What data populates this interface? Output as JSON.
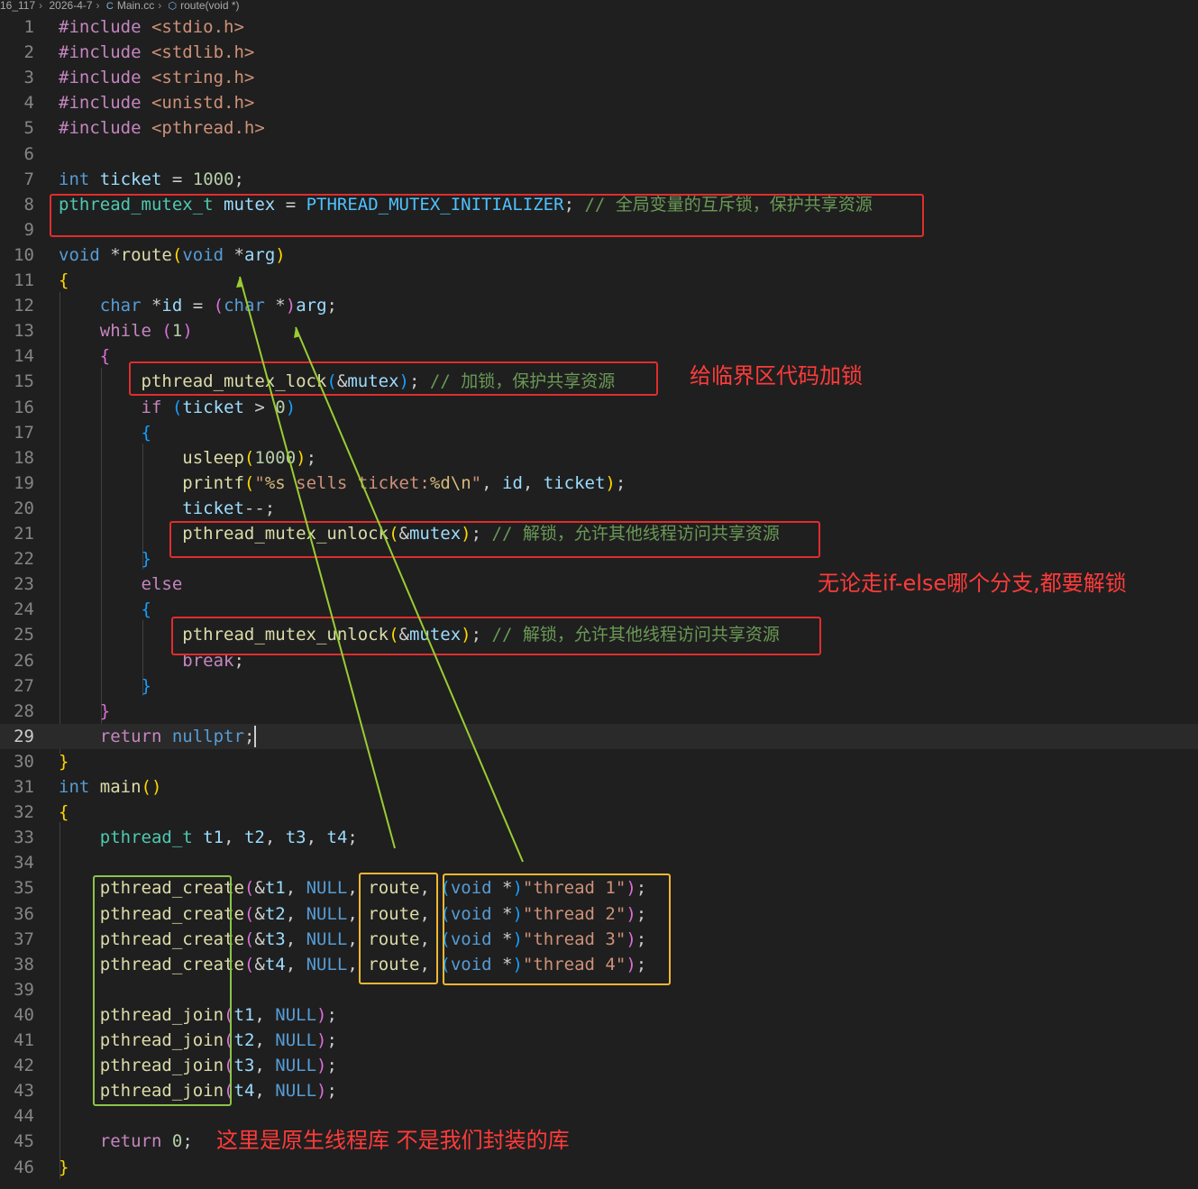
{
  "breadcrumb": [
    "16_117",
    "2026-4-7",
    "Main.cc",
    "route(void *)"
  ],
  "breadcrumb_icons": {
    "file": "cpp-file-icon",
    "symbol": "function-symbol-icon"
  },
  "colors": {
    "red_box": "#e02d2d",
    "yellow_box": "#f2b733",
    "green_box": "#8bc34a",
    "arrow": "#9acd32",
    "note_text": "#ff3b3b"
  },
  "current_line": 29,
  "annotations": {
    "note1": "给临界区代码加锁",
    "note2": "无论走if-else哪个分支,都要解锁",
    "note3": "这里是原生线程库 不是我们封装的库"
  },
  "lines": [
    [
      [
        "#include",
        "pp"
      ],
      [
        " <stdio.h>",
        "inc"
      ]
    ],
    [
      [
        "#include",
        "pp"
      ],
      [
        " <stdlib.h>",
        "inc"
      ]
    ],
    [
      [
        "#include",
        "pp"
      ],
      [
        " <string.h>",
        "inc"
      ]
    ],
    [
      [
        "#include",
        "pp"
      ],
      [
        " <unistd.h>",
        "inc"
      ]
    ],
    [
      [
        "#include",
        "pp"
      ],
      [
        " <pthread.h>",
        "inc"
      ]
    ],
    [],
    [
      [
        "int",
        "kw"
      ],
      [
        " ",
        "plain"
      ],
      [
        "ticket",
        "var"
      ],
      [
        " = ",
        "plain"
      ],
      [
        "1000",
        "num"
      ],
      [
        ";",
        "plain"
      ]
    ],
    [
      [
        "pthread_mutex_t",
        "type"
      ],
      [
        " ",
        "plain"
      ],
      [
        "mutex",
        "var"
      ],
      [
        " = ",
        "plain"
      ],
      [
        "PTHREAD_MUTEX_INITIALIZER",
        "mac"
      ],
      [
        "; ",
        "plain"
      ],
      [
        "// 全局变量的互斥锁，保护共享资源",
        "cmt"
      ]
    ],
    [],
    [
      [
        "void",
        "kw"
      ],
      [
        " *",
        "plain"
      ],
      [
        "route",
        "fn"
      ],
      [
        "(",
        "br1"
      ],
      [
        "void",
        "kw"
      ],
      [
        " *",
        "plain"
      ],
      [
        "arg",
        "var"
      ],
      [
        ")",
        "br1"
      ]
    ],
    [
      [
        "{",
        "br1"
      ]
    ],
    [
      [
        "    ",
        "plain"
      ],
      [
        "char",
        "kw"
      ],
      [
        " *",
        "plain"
      ],
      [
        "id",
        "var"
      ],
      [
        " = ",
        "plain"
      ],
      [
        "(",
        "br2"
      ],
      [
        "char",
        "kw"
      ],
      [
        " *",
        "plain"
      ],
      [
        ")",
        "br2"
      ],
      [
        "arg",
        "var"
      ],
      [
        ";",
        "plain"
      ]
    ],
    [
      [
        "    ",
        "plain"
      ],
      [
        "while",
        "ctl"
      ],
      [
        " ",
        "plain"
      ],
      [
        "(",
        "br2"
      ],
      [
        "1",
        "num"
      ],
      [
        ")",
        "br2"
      ]
    ],
    [
      [
        "    ",
        "plain"
      ],
      [
        "{",
        "br2"
      ]
    ],
    [
      [
        "        ",
        "plain"
      ],
      [
        "pthread_mutex_lock",
        "fn"
      ],
      [
        "(",
        "br3"
      ],
      [
        "&",
        "plain"
      ],
      [
        "mutex",
        "var"
      ],
      [
        ")",
        "br3"
      ],
      [
        "; ",
        "plain"
      ],
      [
        "// 加锁，保护共享资源",
        "cmt"
      ]
    ],
    [
      [
        "        ",
        "plain"
      ],
      [
        "if",
        "ctl"
      ],
      [
        " ",
        "plain"
      ],
      [
        "(",
        "br3"
      ],
      [
        "ticket",
        "var"
      ],
      [
        " > ",
        "plain"
      ],
      [
        "0",
        "num"
      ],
      [
        ")",
        "br3"
      ]
    ],
    [
      [
        "        ",
        "plain"
      ],
      [
        "{",
        "br3"
      ]
    ],
    [
      [
        "            ",
        "plain"
      ],
      [
        "usleep",
        "fn"
      ],
      [
        "(",
        "br1"
      ],
      [
        "1000",
        "num"
      ],
      [
        ")",
        "br1"
      ],
      [
        ";",
        "plain"
      ]
    ],
    [
      [
        "            ",
        "plain"
      ],
      [
        "printf",
        "fn"
      ],
      [
        "(",
        "br1"
      ],
      [
        "\"",
        "str"
      ],
      [
        "%s",
        "esc"
      ],
      [
        " sells ticket:",
        "str"
      ],
      [
        "%d",
        "esc"
      ],
      [
        "\\n",
        "esc"
      ],
      [
        "\"",
        "str"
      ],
      [
        ", ",
        "plain"
      ],
      [
        "id",
        "var"
      ],
      [
        ", ",
        "plain"
      ],
      [
        "ticket",
        "var"
      ],
      [
        ")",
        "br1"
      ],
      [
        ";",
        "plain"
      ]
    ],
    [
      [
        "            ",
        "plain"
      ],
      [
        "ticket",
        "var"
      ],
      [
        "--;",
        "plain"
      ]
    ],
    [
      [
        "            ",
        "plain"
      ],
      [
        "pthread_mutex_unlock",
        "fn"
      ],
      [
        "(",
        "br1"
      ],
      [
        "&",
        "plain"
      ],
      [
        "mutex",
        "var"
      ],
      [
        ")",
        "br1"
      ],
      [
        "; ",
        "plain"
      ],
      [
        "// 解锁，允许其他线程访问共享资源",
        "cmt"
      ]
    ],
    [
      [
        "        ",
        "plain"
      ],
      [
        "}",
        "br3"
      ]
    ],
    [
      [
        "        ",
        "plain"
      ],
      [
        "else",
        "ctl"
      ]
    ],
    [
      [
        "        ",
        "plain"
      ],
      [
        "{",
        "br3"
      ]
    ],
    [
      [
        "            ",
        "plain"
      ],
      [
        "pthread_mutex_unlock",
        "fn"
      ],
      [
        "(",
        "br1"
      ],
      [
        "&",
        "plain"
      ],
      [
        "mutex",
        "var"
      ],
      [
        ")",
        "br1"
      ],
      [
        "; ",
        "plain"
      ],
      [
        "// 解锁，允许其他线程访问共享资源",
        "cmt"
      ]
    ],
    [
      [
        "            ",
        "plain"
      ],
      [
        "break",
        "ctl"
      ],
      [
        ";",
        "plain"
      ]
    ],
    [
      [
        "        ",
        "plain"
      ],
      [
        "}",
        "br3"
      ]
    ],
    [
      [
        "    ",
        "plain"
      ],
      [
        "}",
        "br2"
      ]
    ],
    [
      [
        "    ",
        "plain"
      ],
      [
        "return",
        "ctl"
      ],
      [
        " ",
        "plain"
      ],
      [
        "nullptr",
        "kw"
      ],
      [
        ";",
        "plain"
      ]
    ],
    [
      [
        "}",
        "br1"
      ]
    ],
    [
      [
        "int",
        "kw"
      ],
      [
        " ",
        "plain"
      ],
      [
        "main",
        "fn"
      ],
      [
        "(",
        "br1"
      ],
      [
        ")",
        "br1"
      ]
    ],
    [
      [
        "{",
        "br1"
      ]
    ],
    [
      [
        "    ",
        "plain"
      ],
      [
        "pthread_t",
        "type"
      ],
      [
        " ",
        "plain"
      ],
      [
        "t1",
        "var"
      ],
      [
        ", ",
        "plain"
      ],
      [
        "t2",
        "var"
      ],
      [
        ", ",
        "plain"
      ],
      [
        "t3",
        "var"
      ],
      [
        ", ",
        "plain"
      ],
      [
        "t4",
        "var"
      ],
      [
        ";",
        "plain"
      ]
    ],
    [],
    [
      [
        "    ",
        "plain"
      ],
      [
        "pthread_create",
        "fn"
      ],
      [
        "(",
        "br2"
      ],
      [
        "&",
        "plain"
      ],
      [
        "t1",
        "var"
      ],
      [
        ", ",
        "plain"
      ],
      [
        "NULL",
        "kw"
      ],
      [
        ", ",
        "plain"
      ],
      [
        "route",
        "fn"
      ],
      [
        ", ",
        "plain"
      ],
      [
        "(",
        "br3"
      ],
      [
        "void",
        "kw"
      ],
      [
        " *",
        "plain"
      ],
      [
        ")",
        "br3"
      ],
      [
        "\"thread 1\"",
        "str"
      ],
      [
        ")",
        "br2"
      ],
      [
        ";",
        "plain"
      ]
    ],
    [
      [
        "    ",
        "plain"
      ],
      [
        "pthread_create",
        "fn"
      ],
      [
        "(",
        "br2"
      ],
      [
        "&",
        "plain"
      ],
      [
        "t2",
        "var"
      ],
      [
        ", ",
        "plain"
      ],
      [
        "NULL",
        "kw"
      ],
      [
        ", ",
        "plain"
      ],
      [
        "route",
        "fn"
      ],
      [
        ", ",
        "plain"
      ],
      [
        "(",
        "br3"
      ],
      [
        "void",
        "kw"
      ],
      [
        " *",
        "plain"
      ],
      [
        ")",
        "br3"
      ],
      [
        "\"thread 2\"",
        "str"
      ],
      [
        ")",
        "br2"
      ],
      [
        ";",
        "plain"
      ]
    ],
    [
      [
        "    ",
        "plain"
      ],
      [
        "pthread_create",
        "fn"
      ],
      [
        "(",
        "br2"
      ],
      [
        "&",
        "plain"
      ],
      [
        "t3",
        "var"
      ],
      [
        ", ",
        "plain"
      ],
      [
        "NULL",
        "kw"
      ],
      [
        ", ",
        "plain"
      ],
      [
        "route",
        "fn"
      ],
      [
        ", ",
        "plain"
      ],
      [
        "(",
        "br3"
      ],
      [
        "void",
        "kw"
      ],
      [
        " *",
        "plain"
      ],
      [
        ")",
        "br3"
      ],
      [
        "\"thread 3\"",
        "str"
      ],
      [
        ")",
        "br2"
      ],
      [
        ";",
        "plain"
      ]
    ],
    [
      [
        "    ",
        "plain"
      ],
      [
        "pthread_create",
        "fn"
      ],
      [
        "(",
        "br2"
      ],
      [
        "&",
        "plain"
      ],
      [
        "t4",
        "var"
      ],
      [
        ", ",
        "plain"
      ],
      [
        "NULL",
        "kw"
      ],
      [
        ", ",
        "plain"
      ],
      [
        "route",
        "fn"
      ],
      [
        ", ",
        "plain"
      ],
      [
        "(",
        "br3"
      ],
      [
        "void",
        "kw"
      ],
      [
        " *",
        "plain"
      ],
      [
        ")",
        "br3"
      ],
      [
        "\"thread 4\"",
        "str"
      ],
      [
        ")",
        "br2"
      ],
      [
        ";",
        "plain"
      ]
    ],
    [],
    [
      [
        "    ",
        "plain"
      ],
      [
        "pthread_join",
        "fn"
      ],
      [
        "(",
        "br2"
      ],
      [
        "t1",
        "var"
      ],
      [
        ", ",
        "plain"
      ],
      [
        "NULL",
        "kw"
      ],
      [
        ")",
        "br2"
      ],
      [
        ";",
        "plain"
      ]
    ],
    [
      [
        "    ",
        "plain"
      ],
      [
        "pthread_join",
        "fn"
      ],
      [
        "(",
        "br2"
      ],
      [
        "t2",
        "var"
      ],
      [
        ", ",
        "plain"
      ],
      [
        "NULL",
        "kw"
      ],
      [
        ")",
        "br2"
      ],
      [
        ";",
        "plain"
      ]
    ],
    [
      [
        "    ",
        "plain"
      ],
      [
        "pthread_join",
        "fn"
      ],
      [
        "(",
        "br2"
      ],
      [
        "t3",
        "var"
      ],
      [
        ", ",
        "plain"
      ],
      [
        "NULL",
        "kw"
      ],
      [
        ")",
        "br2"
      ],
      [
        ";",
        "plain"
      ]
    ],
    [
      [
        "    ",
        "plain"
      ],
      [
        "pthread_join",
        "fn"
      ],
      [
        "(",
        "br2"
      ],
      [
        "t4",
        "var"
      ],
      [
        ", ",
        "plain"
      ],
      [
        "NULL",
        "kw"
      ],
      [
        ")",
        "br2"
      ],
      [
        ";",
        "plain"
      ]
    ],
    [],
    [
      [
        "    ",
        "plain"
      ],
      [
        "return",
        "ctl"
      ],
      [
        " ",
        "plain"
      ],
      [
        "0",
        "num"
      ],
      [
        ";",
        "plain"
      ]
    ],
    [
      [
        "}",
        "br1"
      ]
    ]
  ]
}
